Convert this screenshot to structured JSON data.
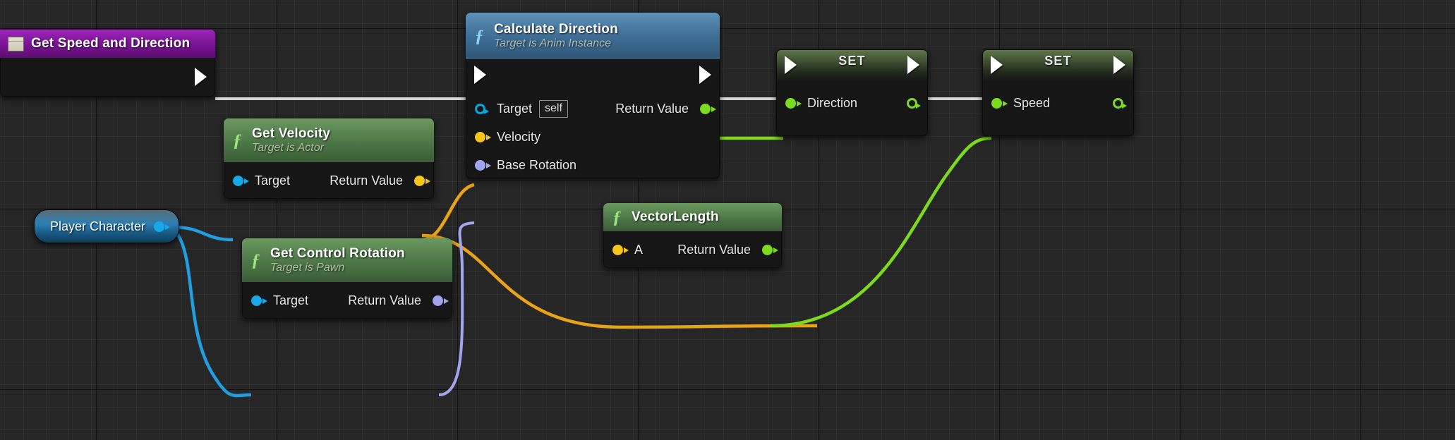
{
  "graph": {
    "title": "Unreal Engine Blueprint Event Graph",
    "background_color": "#262626",
    "grid_color": "#303030"
  },
  "nodes": [
    {
      "id": "get-speed-and-direction",
      "kind": "event",
      "title": "Get Speed and Direction",
      "subtitle": "",
      "icon": "event-node-icon",
      "header_color": "#8a19a8",
      "outputs": [
        {
          "name": "exec-out",
          "label": "",
          "type": "exec"
        }
      ]
    },
    {
      "id": "calculate-direction",
      "kind": "function",
      "title": "Calculate Direction",
      "subtitle": "Target is Anim Instance",
      "icon": "function-f-icon",
      "header_color": "#3d6f96",
      "inputs": [
        {
          "name": "exec-in",
          "label": "",
          "type": "exec"
        },
        {
          "name": "target",
          "label": "Target",
          "type": "object",
          "color": "#00a9e0",
          "default_value": "self"
        },
        {
          "name": "velocity",
          "label": "Velocity",
          "type": "vector",
          "color": "#f5c518"
        },
        {
          "name": "base-rotation",
          "label": "Base Rotation",
          "type": "rotator",
          "color": "#a1a5ee"
        }
      ],
      "outputs": [
        {
          "name": "exec-out",
          "label": "",
          "type": "exec"
        },
        {
          "name": "return-value",
          "label": "Return Value",
          "type": "float",
          "color": "#7cdb1c"
        }
      ]
    },
    {
      "id": "get-velocity",
      "kind": "function-pure",
      "title": "Get Velocity",
      "subtitle": "Target is Actor",
      "icon": "function-f-icon",
      "header_color": "#4c7a46",
      "inputs": [
        {
          "name": "target",
          "label": "Target",
          "type": "object",
          "color": "#00a9e0"
        }
      ],
      "outputs": [
        {
          "name": "return-value",
          "label": "Return Value",
          "type": "vector",
          "color": "#f5c518"
        }
      ]
    },
    {
      "id": "get-control-rotation",
      "kind": "function-pure",
      "title": "Get Control Rotation",
      "subtitle": "Target is Pawn",
      "icon": "function-f-icon",
      "header_color": "#4c7a46",
      "inputs": [
        {
          "name": "target",
          "label": "Target",
          "type": "object",
          "color": "#00a9e0"
        }
      ],
      "outputs": [
        {
          "name": "return-value",
          "label": "Return Value",
          "type": "rotator",
          "color": "#a1a5ee"
        }
      ]
    },
    {
      "id": "vector-length",
      "kind": "function-pure",
      "title": "VectorLength",
      "subtitle": "",
      "icon": "function-f-icon",
      "header_color": "#4c7a46",
      "inputs": [
        {
          "name": "a",
          "label": "A",
          "type": "vector",
          "color": "#f5c518"
        }
      ],
      "outputs": [
        {
          "name": "return-value",
          "label": "Return Value",
          "type": "float",
          "color": "#7cdb1c"
        }
      ]
    },
    {
      "id": "set-direction",
      "kind": "set",
      "title": "SET",
      "inputs": [
        {
          "name": "exec-in",
          "label": "",
          "type": "exec"
        },
        {
          "name": "direction",
          "label": "Direction",
          "type": "float",
          "color": "#7cdb1c"
        }
      ],
      "outputs": [
        {
          "name": "exec-out",
          "label": "",
          "type": "exec"
        },
        {
          "name": "direction-out",
          "label": "",
          "type": "float",
          "color": "#7cdb1c"
        }
      ]
    },
    {
      "id": "set-speed",
      "kind": "set",
      "title": "SET",
      "inputs": [
        {
          "name": "exec-in",
          "label": "",
          "type": "exec"
        },
        {
          "name": "speed",
          "label": "Speed",
          "type": "float",
          "color": "#7cdb1c"
        }
      ],
      "outputs": [
        {
          "name": "exec-out",
          "label": "",
          "type": "exec"
        },
        {
          "name": "speed-out",
          "label": "",
          "type": "float",
          "color": "#7cdb1c"
        }
      ]
    },
    {
      "id": "player-character",
      "kind": "variable-get",
      "title": "Player Character",
      "header_color": "#1d7ec4",
      "outputs": [
        {
          "name": "value",
          "label": "",
          "type": "object",
          "color": "#00a9e0"
        }
      ]
    }
  ],
  "labels": {
    "get_speed_and_direction": "Get Speed and Direction",
    "calculate_direction": "Calculate Direction",
    "calculate_direction_sub": "Target is Anim Instance",
    "get_velocity": "Get Velocity",
    "get_velocity_sub": "Target is Actor",
    "get_control_rotation": "Get Control Rotation",
    "get_control_rotation_sub": "Target is Pawn",
    "vector_length": "VectorLength",
    "player_character": "Player Character",
    "set": "SET",
    "target": "Target",
    "self": "self",
    "velocity": "Velocity",
    "base_rotation": "Base Rotation",
    "return_value": "Return Value",
    "direction": "Direction",
    "speed": "Speed",
    "a": "A"
  },
  "wire_colors": {
    "exec": "#d6d6d6",
    "object": "#00a9e0",
    "vector": "#e8a317",
    "rotator": "#a1a5ee",
    "float": "#7cdb1c"
  }
}
